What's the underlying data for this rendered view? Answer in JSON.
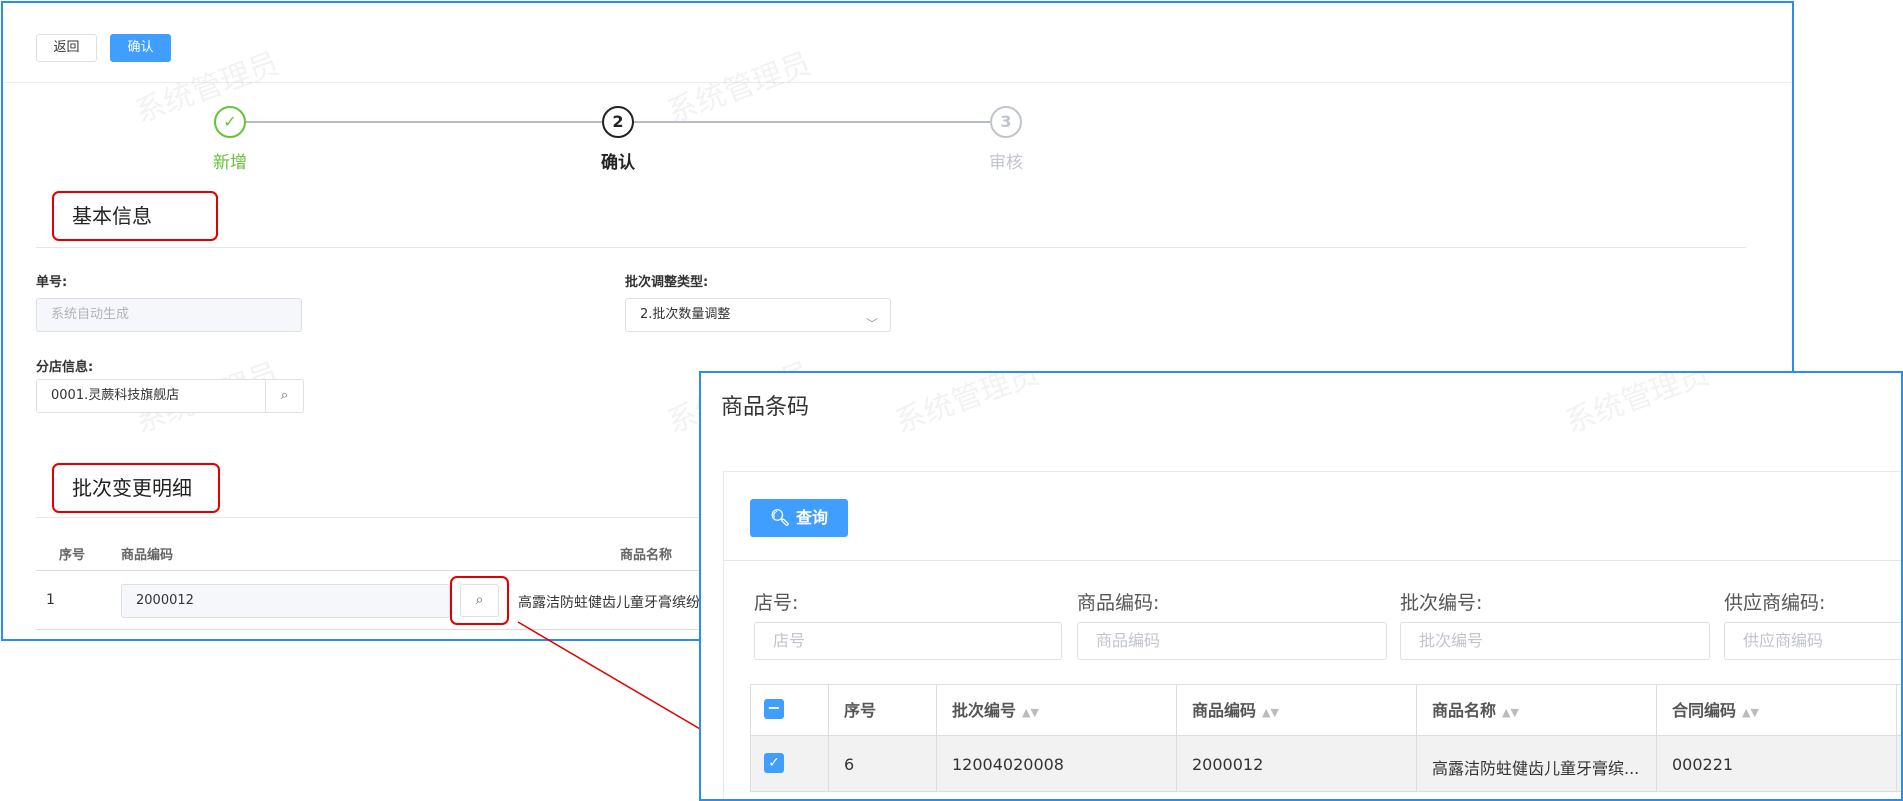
{
  "toolbar": {
    "back_label": "返回",
    "confirm_label": "确认"
  },
  "steps": [
    {
      "number": "✓",
      "label": "新增",
      "status": "done"
    },
    {
      "number": "2",
      "label": "确认",
      "status": "active"
    },
    {
      "number": "3",
      "label": "审核",
      "status": "wait"
    }
  ],
  "basic_info": {
    "title": "基本信息",
    "order_no_label": "单号:",
    "order_no_placeholder": "系统自动生成",
    "adjust_type_label": "批次调整类型:",
    "adjust_type_value": "2.批次数量调整",
    "branch_label": "分店信息:",
    "branch_value": "0001.灵蕨科技旗舰店"
  },
  "detail": {
    "title": "批次变更明细",
    "columns": [
      "序号",
      "商品编码",
      "商品名称"
    ],
    "rows": [
      {
        "index": "1",
        "code": "2000012",
        "name": "高露洁防蛀健齿儿童牙膏缤纷"
      }
    ]
  },
  "watermark": "系统管理员",
  "dialog": {
    "title": "商品条码",
    "query_label": "查询",
    "filters": [
      {
        "label": "店号:",
        "placeholder": "店号"
      },
      {
        "label": "商品编码:",
        "placeholder": "商品编码"
      },
      {
        "label": "批次编号:",
        "placeholder": "批次编号"
      },
      {
        "label": "供应商编码:",
        "placeholder": "供应商编码"
      }
    ],
    "columns": [
      "序号",
      "批次编号",
      "商品编码",
      "商品名称",
      "合同编码"
    ],
    "rows": [
      {
        "index": "6",
        "batch_no": "12004020008",
        "code": "2000012",
        "name": "高露洁防蛀健齿儿童牙膏缤...",
        "contract": "000221",
        "checked": true
      }
    ]
  },
  "colors": {
    "accent": "#409eff",
    "highlight": "#e00000",
    "success": "#67c23a",
    "frame": "#2d8cf0"
  }
}
